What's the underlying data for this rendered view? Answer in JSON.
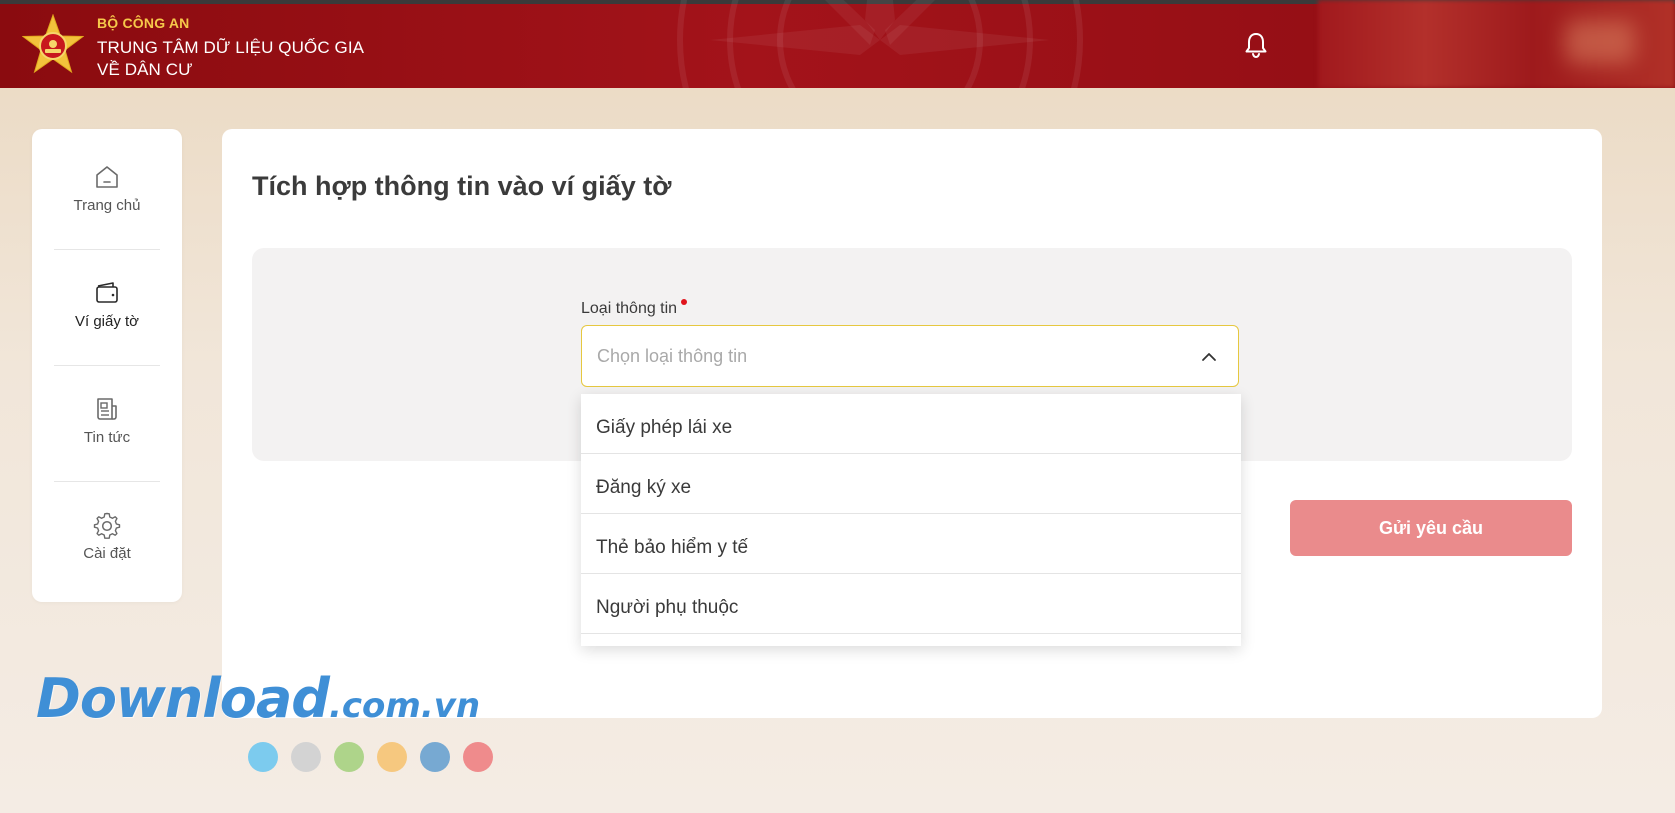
{
  "header": {
    "ministry": "BỘ CÔNG AN",
    "center_line1": "TRUNG TÂM DỮ LIỆU QUỐC GIA",
    "center_line2": "VỀ DÂN CƯ",
    "notification_icon": "bell-icon"
  },
  "sidebar": {
    "items": [
      {
        "label": "Trang chủ",
        "icon": "home-icon",
        "active": false
      },
      {
        "label": "Ví giấy tờ",
        "icon": "wallet-icon",
        "active": true
      },
      {
        "label": "Tin tức",
        "icon": "news-icon",
        "active": false
      },
      {
        "label": "Cài đặt",
        "icon": "gear-icon",
        "active": false
      }
    ]
  },
  "main": {
    "title": "Tích hợp thông tin vào ví giấy tờ",
    "field": {
      "label": "Loại thông tin",
      "required": true,
      "placeholder": "Chọn loại thông tin",
      "expanded": true
    },
    "options": [
      "Giấy phép lái xe",
      "Đăng ký xe",
      "Thẻ bảo hiểm y tế",
      "Người phụ thuộc"
    ],
    "submit_label": "Gửi yêu cầu"
  },
  "watermark": {
    "text_big": "Download",
    "text_small": ".com.vn",
    "dot_colors": [
      "#7ccbee",
      "#d3d3d3",
      "#aed48a",
      "#f6c87f",
      "#77a9d2",
      "#ef8b8c"
    ]
  },
  "colors": {
    "header_red": "#a3131a",
    "accent_yellow": "#f6c84a",
    "select_border": "#e6c840",
    "submit_bg": "#ea8b8c",
    "required_dot": "#e0141c"
  }
}
